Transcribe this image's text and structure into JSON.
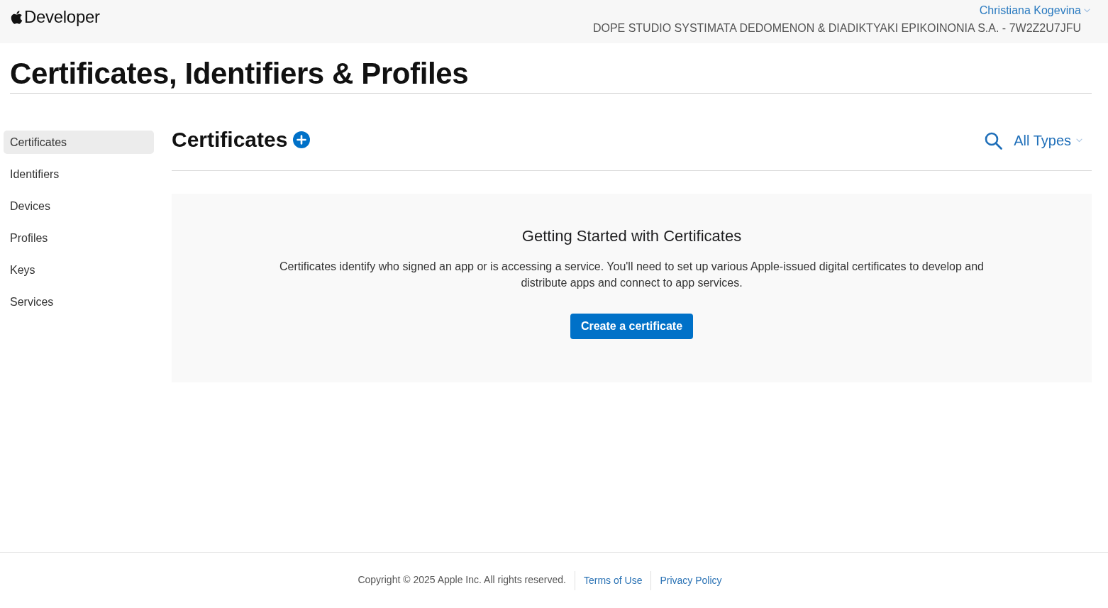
{
  "header": {
    "brand": "Developer",
    "user_name": "Christiana Kogevina",
    "team": "DOPE STUDIO SYSTIMATA DEDOMENON & DIADIKTYAKI EPIKOINONIA S.A. - 7W2Z2U7JFU"
  },
  "page_title": "Certificates, Identifiers & Profiles",
  "sidebar": {
    "items": [
      {
        "label": "Certificates",
        "selected": true
      },
      {
        "label": "Identifiers",
        "selected": false
      },
      {
        "label": "Devices",
        "selected": false
      },
      {
        "label": "Profiles",
        "selected": false
      },
      {
        "label": "Keys",
        "selected": false
      },
      {
        "label": "Services",
        "selected": false
      }
    ]
  },
  "section": {
    "title": "Certificates",
    "filter": "All Types"
  },
  "empty_state": {
    "title": "Getting Started with Certificates",
    "text": "Certificates identify who signed an app or is accessing a service. You'll need to set up various Apple-issued digital certificates to develop and distribute apps and connect to app services.",
    "button": "Create a certificate"
  },
  "footer": {
    "copyright": "Copyright © 2025 Apple Inc. All rights reserved.",
    "links": [
      "Terms of Use",
      "Privacy Policy"
    ]
  }
}
